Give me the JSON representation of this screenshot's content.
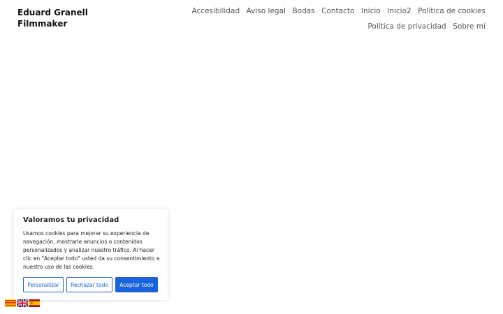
{
  "site": {
    "title": "Eduard Granell Filmmaker"
  },
  "nav": {
    "items": [
      "Accesibilidad",
      "Aviso legal",
      "Bodas",
      "Contacto",
      "Inicio",
      "Inicio2",
      "Política de cookies",
      "Política de privacidad",
      "Sobre mí"
    ]
  },
  "cookie_banner": {
    "title": "Valoramos tu privacidad",
    "text": "Usamos cookies para mejorar su experiencia de navegación, mostrarle anuncios o contenidos personalizados y analizar nuestro tráfico. Al hacer clic en \"Aceptar todo\" usted da su consentimiento a nuestro uso de las cookies.",
    "customize_label": "Personalizar",
    "reject_label": "Rechazar todo",
    "accept_label": "Aceptar todo",
    "accent_color": "#1863dc"
  },
  "language_flags": [
    {
      "icon": "catalan-flag-icon"
    },
    {
      "icon": "uk-flag-icon"
    },
    {
      "icon": "spanish-flag-icon"
    }
  ]
}
